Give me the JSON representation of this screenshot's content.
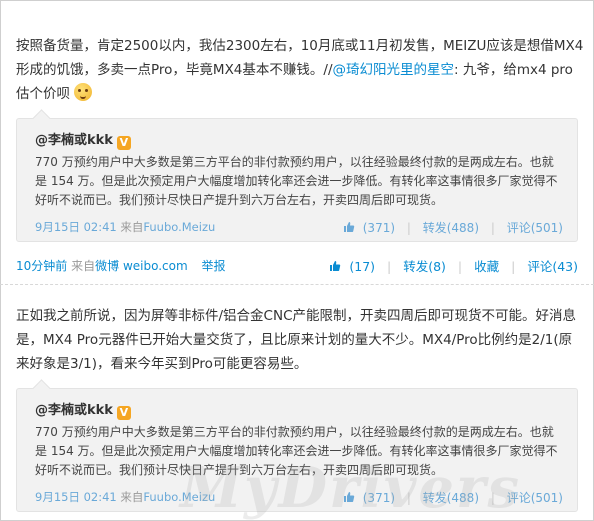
{
  "post1": {
    "text_prefix": "按照备货量，肯定2500以内，我估2300左右，10月底或11月初发售，MEIZU应该是想借MX4形成的饥饿，多卖一点Pro，毕竟MX4基本不赚钱。//",
    "mention": "@琦幻阳光里的星空",
    "text_suffix": ": 九爷，给mx4 pro估个价呗",
    "quote": {
      "author": "@李楠或kkk",
      "badge": "V",
      "text": "770 万预约用户中大多数是第三方平台的非付款预约用户，以往经验最终付款的是两成左右。也就是 154 万。但是此次预定用户大幅度增加转化率还会进一步降低。有转化率这事情很多厂家觉得不好听不说而已。我们预计尽快日产提升到六万台左右，开卖四周后即可现货。",
      "time": "9月15日 02:41",
      "from": "来自",
      "source": "Fuubo.Meizu",
      "likes": "(371)",
      "repost": "转发(488)",
      "comment": "评论(501)"
    },
    "meta": {
      "time": "10分钟前",
      "from": "来自",
      "source": "微博 weibo.com",
      "report": "举报"
    },
    "actions": {
      "likes": "(17)",
      "repost": "转发(8)",
      "favorite": "收藏",
      "comment": "评论(43)"
    }
  },
  "post2": {
    "text": "正如我之前所说，因为屏等非标件/铝合金CNC产能限制，开卖四周后即可现货不可能。好消息是，MX4 Pro元器件已开始大量交货了，且比原来计划的量大不少。MX4/Pro比例约是2/1(原来好象是3/1)，看来今年买到Pro可能更容易些。",
    "quote": {
      "author": "@李楠或kkk",
      "badge": "V",
      "text": "770 万预约用户中大多数是第三方平台的非付款预约用户，以往经验最终付款的是两成左右。也就是 154 万。但是此次预定用户大幅度增加转化率还会进一步降低。有转化率这事情很多厂家觉得不好听不说而已。我们预计尽快日产提升到六万台左右，开卖四周后即可现货。",
      "time": "9月15日 02:41",
      "from": "来自",
      "source": "Fuubo.Meizu",
      "likes": "(371)",
      "repost": "转发(488)",
      "comment": "评论(501)"
    }
  },
  "watermark": "MyDrivers"
}
